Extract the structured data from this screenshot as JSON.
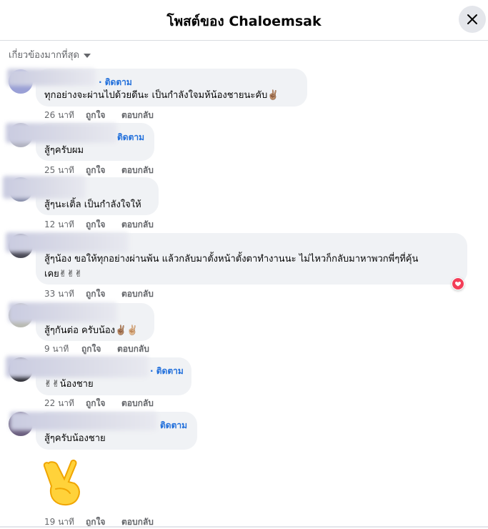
{
  "header": {
    "title": "โพสต์ของ Chaloemsak",
    "close_icon": "close-icon"
  },
  "sort": {
    "label": "เกี่ยวข้องมากที่สุด",
    "icon": "caret-down-icon"
  },
  "comments": [
    {
      "follow": "· ติดตาม",
      "text": "ทุกอย่างจะผ่านไปด้วยดีนะ เป็นกำลังใจมห้น้องชายนะคับ✌🏽",
      "time": "26 นาที",
      "like": "ถูกใจ",
      "reply": "ตอบกลับ"
    },
    {
      "follow": "ติดตาม",
      "text": "สู้ๆครับผม",
      "time": "25 นาที",
      "like": "ถูกใจ",
      "reply": "ตอบกลับ"
    },
    {
      "text": "สู้ๆนะเติ้ล เป็นกำลังใจให้",
      "time": "12 นาที",
      "like": "ถูกใจ",
      "reply": "ตอบกลับ"
    },
    {
      "text_line1": "สู้ๆน้อง ขอให้ทุกอย่างผ่านพ้น แล้วกลับมาตั้งหน้าตั้งตาทำงานนะ ไม่ไหวก็กลับมาหาพวกพี่ๆที่คุ้น",
      "text_line2": "เคย✌✌✌",
      "time": "33 นาที",
      "like": "ถูกใจ",
      "reply": "ตอบกลับ",
      "reaction": "love-reaction-icon"
    },
    {
      "text": "สู้ๆกันต่อ ครับน้อง✌🏽✌🏼",
      "time": "9 นาที",
      "like": "ถูกใจ",
      "reply": "ตอบกลับ"
    },
    {
      "follow": "· ติดตาม",
      "text": "✌✌น้องชาย",
      "time": "22 นาที",
      "like": "ถูกใจ",
      "reply": "ตอบกลับ"
    },
    {
      "follow": "ติดตาม",
      "text": "สู้ๆครับน้องชาย",
      "time": "19 นาที",
      "like": "ถูกใจ",
      "reply": "ตอบกลับ",
      "sticker": "victory-hand-sticker"
    }
  ]
}
